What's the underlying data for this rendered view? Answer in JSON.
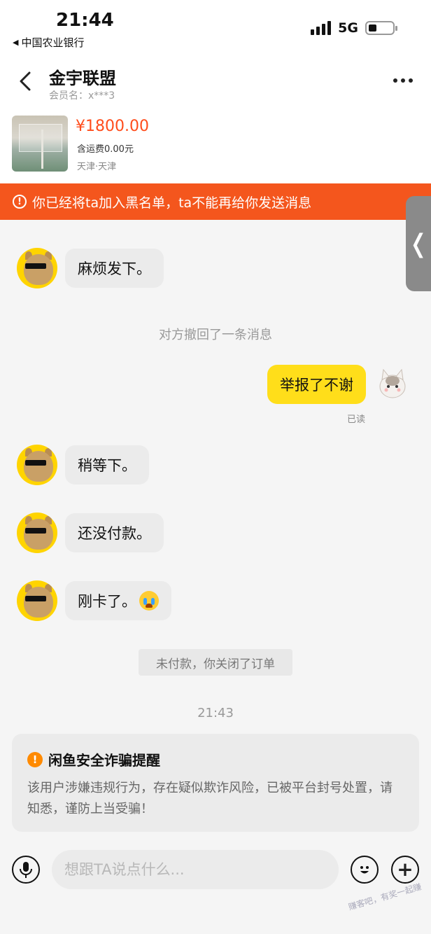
{
  "status_bar": {
    "time": "21:44",
    "back_app": "中国农业银行",
    "network": "5G"
  },
  "header": {
    "title": "金宇联盟",
    "member_label": "会员名",
    "member_name": "x***3",
    "member_text": "会员名：x***3"
  },
  "product": {
    "price": "¥1800.00",
    "shipping": "含运费0.00元",
    "location": "天津·天津"
  },
  "banner": {
    "text": "你已经将ta加入黑名单，ta不能再给你发送消息",
    "color": "#f4561d"
  },
  "messages": [
    {
      "from": "other",
      "text": "麻烦发下。"
    },
    {
      "type": "system",
      "text": "对方撤回了一条消息"
    },
    {
      "from": "me",
      "text": "举报了不谢",
      "status": "已读"
    },
    {
      "from": "other",
      "text": "稍等下。"
    },
    {
      "from": "other",
      "text": "还没付款。"
    },
    {
      "from": "other",
      "text": "刚卡了。",
      "emoji": "crying-face-icon"
    },
    {
      "type": "system",
      "text": "未付款，你关闭了订单"
    },
    {
      "type": "time",
      "text": "21:43"
    }
  ],
  "warning": {
    "title": "闲鱼安全诈骗提醒",
    "body": "该用户涉嫌违规行为，存在疑似欺诈风险，已被平台封号处置，请知悉，谨防上当受骗！"
  },
  "input": {
    "placeholder": "想跟TA说点什么..."
  },
  "watermark": "赚客吧，有奖一起赚"
}
